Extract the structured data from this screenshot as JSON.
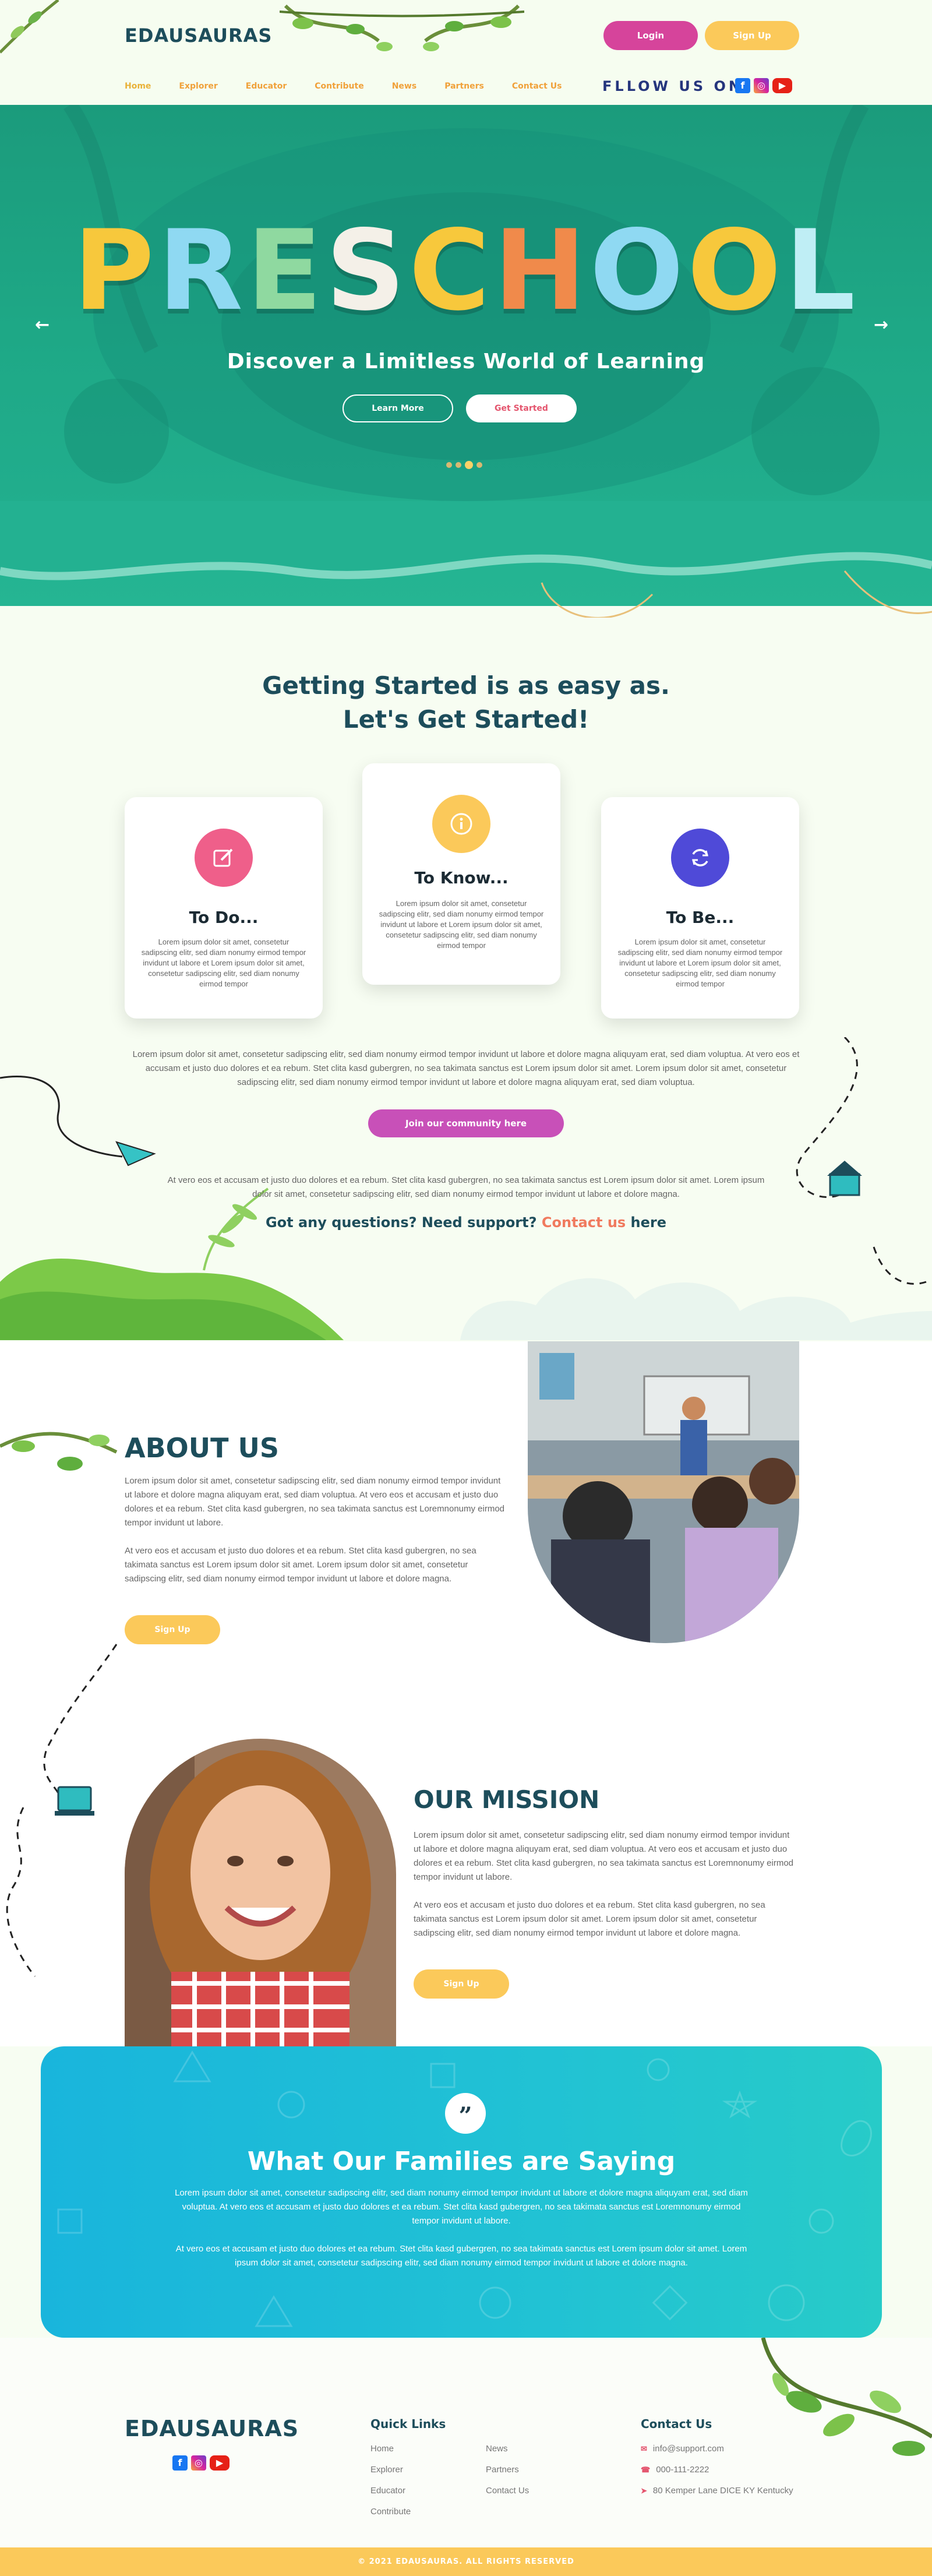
{
  "brand": {
    "name": "EDAUSAURAS"
  },
  "header": {
    "login_label": "Login",
    "signup_label": "Sign Up",
    "nav": [
      "Home",
      "Explorer",
      "Educator",
      "Contribute",
      "News",
      "Partners",
      "Contact Us"
    ],
    "follow_label": "FLLOW US ON",
    "social": [
      "facebook-icon",
      "instagram-icon",
      "youtube-icon"
    ]
  },
  "hero": {
    "title_letters": [
      "P",
      "R",
      "E",
      "S",
      "C",
      "H",
      "O",
      "O",
      "L"
    ],
    "title_colors": [
      "#f7c83c",
      "#8fd9f2",
      "#8fd9a0",
      "#f4f0e8",
      "#f7c83c",
      "#f08a4b",
      "#8fd9f2",
      "#f7c83c",
      "#bfeef5"
    ],
    "subtitle": "Discover a Limitless World of Learning",
    "learn_more": "Learn More",
    "get_started": "Get Started"
  },
  "getting_started": {
    "title_line1": "Getting Started is as easy as.",
    "title_line2": "Let's Get Started!",
    "cards": [
      {
        "title": "To Do...",
        "text": "Lorem ipsum dolor sit amet, consetetur sadipscing elitr, sed diam nonumy eirmod tempor invidunt ut labore et Lorem ipsum dolor sit amet, consetetur sadipscing elitr, sed diam nonumy eirmod tempor"
      },
      {
        "title": "To Know...",
        "text": "Lorem ipsum dolor sit amet, consetetur sadipscing elitr, sed diam nonumy eirmod tempor invidunt ut labore et Lorem ipsum dolor sit amet, consetetur sadipscing elitr, sed diam nonumy eirmod tempor"
      },
      {
        "title": "To Be...",
        "text": "Lorem ipsum dolor sit amet, consetetur sadipscing elitr, sed diam nonumy eirmod tempor invidunt ut labore et Lorem ipsum dolor sit amet, consetetur sadipscing elitr, sed diam nonumy eirmod tempor"
      }
    ],
    "paragraph": "Lorem ipsum dolor sit amet, consetetur sadipscing elitr, sed diam nonumy eirmod tempor invidunt ut labore et dolore magna aliquyam erat, sed diam voluptua. At vero eos et accusam et justo duo dolores et ea rebum. Stet clita kasd gubergren, no sea takimata sanctus est Lorem ipsum dolor sit amet. Lorem ipsum dolor sit amet, consetetur sadipscing elitr, sed diam nonumy eirmod tempor invidunt ut labore et dolore magna aliquyam erat, sed diam voluptua.",
    "community_button": "Join our community here",
    "paragraph2": "At vero eos et accusam et justo duo dolores et ea rebum. Stet clita kasd gubergren, no sea takimata sanctus est Lorem ipsum dolor sit amet. Lorem ipsum dolor sit amet, consetetur sadipscing elitr, sed diam nonumy eirmod tempor invidunt ut labore et dolore magna.",
    "question_prefix": "Got any questions? Need support?",
    "question_link": "Contact us",
    "question_suffix": "here"
  },
  "about": {
    "title": "ABOUT US",
    "p1": "Lorem ipsum dolor sit amet, consetetur sadipscing elitr, sed diam nonumy eirmod tempor invidunt ut labore et dolore magna aliquyam erat, sed diam voluptua. At vero eos et accusam et justo duo dolores et ea rebum. Stet clita kasd gubergren, no sea takimata sanctus est Loremnonumy eirmod tempor invidunt ut labore.",
    "p2": "At vero eos et accusam et justo duo dolores et ea rebum. Stet clita kasd gubergren, no sea takimata sanctus est Lorem ipsum dolor sit amet. Lorem ipsum dolor sit amet, consetetur sadipscing elitr, sed diam nonumy eirmod tempor invidunt ut labore et dolore magna.",
    "button": "Sign Up"
  },
  "mission": {
    "title": "OUR MISSION",
    "p1": "Lorem ipsum dolor sit amet, consetetur sadipscing elitr, sed diam nonumy eirmod tempor invidunt ut labore et dolore magna aliquyam erat, sed diam voluptua. At vero eos et accusam et justo duo dolores et ea rebum. Stet clita kasd gubergren, no sea takimata sanctus est Loremnonumy eirmod tempor invidunt ut labore.",
    "p2": "At vero eos et accusam et justo duo dolores et ea rebum. Stet clita kasd gubergren, no sea takimata sanctus est Lorem ipsum dolor sit amet. Lorem ipsum dolor sit amet, consetetur sadipscing elitr, sed diam nonumy eirmod tempor invidunt ut labore et dolore magna.",
    "button": "Sign Up"
  },
  "testimonials": {
    "quote_mark": "”",
    "title": "What Our Families are Saying",
    "p1": "Lorem ipsum dolor sit amet, consetetur sadipscing elitr, sed diam nonumy eirmod tempor invidunt ut labore et dolore magna aliquyam erat, sed diam voluptua. At vero eos et accusam et justo duo dolores et ea rebum. Stet clita kasd gubergren, no sea takimata sanctus est Loremnonumy eirmod tempor invidunt ut labore.",
    "p2": "At vero eos et accusam et justo duo dolores et ea rebum. Stet clita kasd gubergren, no sea takimata sanctus est Lorem ipsum dolor sit amet. Lorem ipsum dolor sit amet, consetetur sadipscing elitr, sed diam nonumy eirmod tempor invidunt ut labore et dolore magna."
  },
  "footer": {
    "logo": "EDAUSAURAS",
    "quick_links_title": "Quick Links",
    "links_col1": [
      "Home",
      "Explorer",
      "Educator",
      "Contribute"
    ],
    "links_col2": [
      "News",
      "Partners",
      "Contact Us"
    ],
    "contact_title": "Contact Us",
    "email": "info@support.com",
    "phone": "000-111-2222",
    "address": "80  Kemper Lane DICE KY Kentucky",
    "copyright": "© 2021 EDAUSAURAS. ALL RIGHTS RESERVED"
  },
  "colors": {
    "primary_dark": "#1d4d5b",
    "pink": "#d6449b",
    "yellow": "#fbc95a",
    "teal": "#1ea886",
    "cyan": "#21c2d4"
  }
}
